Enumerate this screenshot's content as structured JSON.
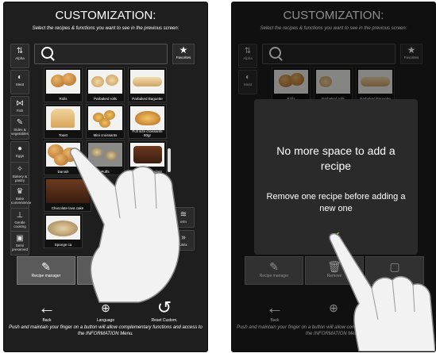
{
  "title": "CUSTOMIZATION:",
  "subtitle": "Select the recipes & functions you want to see in the previous screen:",
  "sidebar": [
    {
      "label": "Alpha",
      "icon": "alpha-sort-icon",
      "glyph": "⇅"
    },
    {
      "label": "Meat",
      "icon": "meat-icon",
      "glyph": "◐"
    },
    {
      "label": "Fish",
      "icon": "fish-icon",
      "glyph": "⋈"
    },
    {
      "label": "Sides & vegetables",
      "icon": "carrot-icon",
      "glyph": "✎"
    },
    {
      "label": "Eggs",
      "icon": "egg-icon",
      "glyph": "●"
    },
    {
      "label": "Bakery & pastry",
      "icon": "whisk-icon",
      "glyph": "✧"
    },
    {
      "label": "Bake convenience",
      "icon": "chef-hat-icon",
      "glyph": "♛"
    },
    {
      "label": "Gentle cooking",
      "icon": "thermometer-icon",
      "glyph": "⊥"
    },
    {
      "label": "Semi preserved",
      "icon": "jar-icon",
      "glyph": "▣"
    }
  ],
  "favorites_label": "Favorites",
  "recipes": [
    {
      "label": "Rolls"
    },
    {
      "label": "Parbaked rolls"
    },
    {
      "label": "Parbaked Baguette"
    },
    {
      "label": "Toast"
    },
    {
      "label": "Mini croissants"
    },
    {
      "label": "Full size croissants 80gr"
    },
    {
      "label": "Danish"
    },
    {
      "label": "Puffs"
    },
    {
      "label": "Chocolate fondant"
    },
    {
      "label": "Chocolate lava cake"
    },
    {
      "label": ""
    },
    {
      "label": ""
    },
    {
      "label": "Sponge ca"
    },
    {
      "label": ""
    }
  ],
  "functions": [
    {
      "label": "erm",
      "icon": "steam-icon",
      "glyph": "≋"
    },
    {
      "label": "uMix",
      "icon": "chevrons-icon",
      "glyph": "»"
    }
  ],
  "buttons": {
    "recipe_manager": "Recipe manager",
    "remove": "Remove",
    "back": "Back",
    "language": "Language",
    "reset": "Reset Custom."
  },
  "footer": "Push and maintain your finger on a button will allow complementary functions and access to the INFORMATION Menu.",
  "dialog": {
    "heading": "No more space to add a recipe",
    "message": "Remove one recipe before adding a new one",
    "confirm_glyph": "✔"
  },
  "colors": {
    "screen_bg": "#1e1e1e",
    "confirm": "#7dc242",
    "button_bg": "#5a5a5a"
  }
}
